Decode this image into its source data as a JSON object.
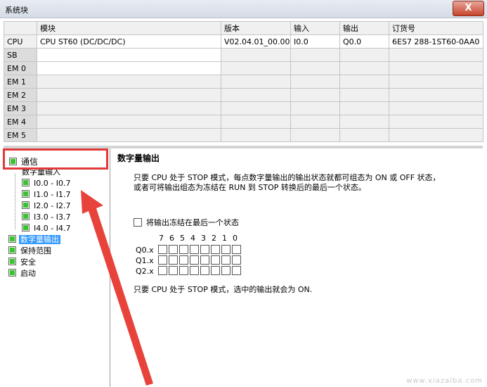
{
  "window": {
    "title": "系统块",
    "close_label": "X"
  },
  "table": {
    "headers": [
      "",
      "模块",
      "版本",
      "输入",
      "输出",
      "订货号"
    ],
    "rows": [
      {
        "slot": "CPU",
        "module": "CPU ST60 (DC/DC/DC)",
        "version": "V02.04.01_00.00...",
        "input": "I0.0",
        "output": "Q0.0",
        "order": "6ES7 288-1ST60-0AA0"
      },
      {
        "slot": "SB",
        "module": "",
        "version": "",
        "input": "",
        "output": "",
        "order": ""
      },
      {
        "slot": "EM 0",
        "module": "",
        "version": "",
        "input": "",
        "output": "",
        "order": ""
      },
      {
        "slot": "EM 1",
        "module": "",
        "version": "",
        "input": "",
        "output": "",
        "order": ""
      },
      {
        "slot": "EM 2",
        "module": "",
        "version": "",
        "input": "",
        "output": "",
        "order": ""
      },
      {
        "slot": "EM 3",
        "module": "",
        "version": "",
        "input": "",
        "output": "",
        "order": ""
      },
      {
        "slot": "EM 4",
        "module": "",
        "version": "",
        "input": "",
        "output": "",
        "order": ""
      },
      {
        "slot": "EM 5",
        "module": "",
        "version": "",
        "input": "",
        "output": "",
        "order": ""
      }
    ]
  },
  "tree": {
    "highlighted": "通信",
    "digital_input": "数字量输入",
    "inputs": [
      "I0.0 - I0.7",
      "I1.0 - I1.7",
      "I2.0 - I2.7",
      "I3.0 - I3.7",
      "I4.0 - I4.7"
    ],
    "digital_output": "数字量输出",
    "retentive": "保持范围",
    "security": "安全",
    "startup": "启动"
  },
  "panel": {
    "title": "数字量输出",
    "desc": "只要 CPU 处于 STOP 模式，每点数字量输出的输出状态就都可组态为 ON 或 OFF 状态，或者可将输出组态为冻结在 RUN 到 STOP 转换后的最后一个状态。",
    "freeze_label": "将输出冻结在最后一个状态",
    "bit_headers": [
      "7",
      "6",
      "5",
      "4",
      "3",
      "2",
      "1",
      "0"
    ],
    "rows": [
      "Q0.x",
      "Q1.x",
      "Q2.x"
    ],
    "note": "只要 CPU 处于 STOP 模式，选中的输出就会为 ON."
  },
  "watermark": "www.xiazaiba.com",
  "colors": {
    "highlight_red": "#e03a3a",
    "select_blue": "#3399ff",
    "status_green": "#36c52f"
  }
}
